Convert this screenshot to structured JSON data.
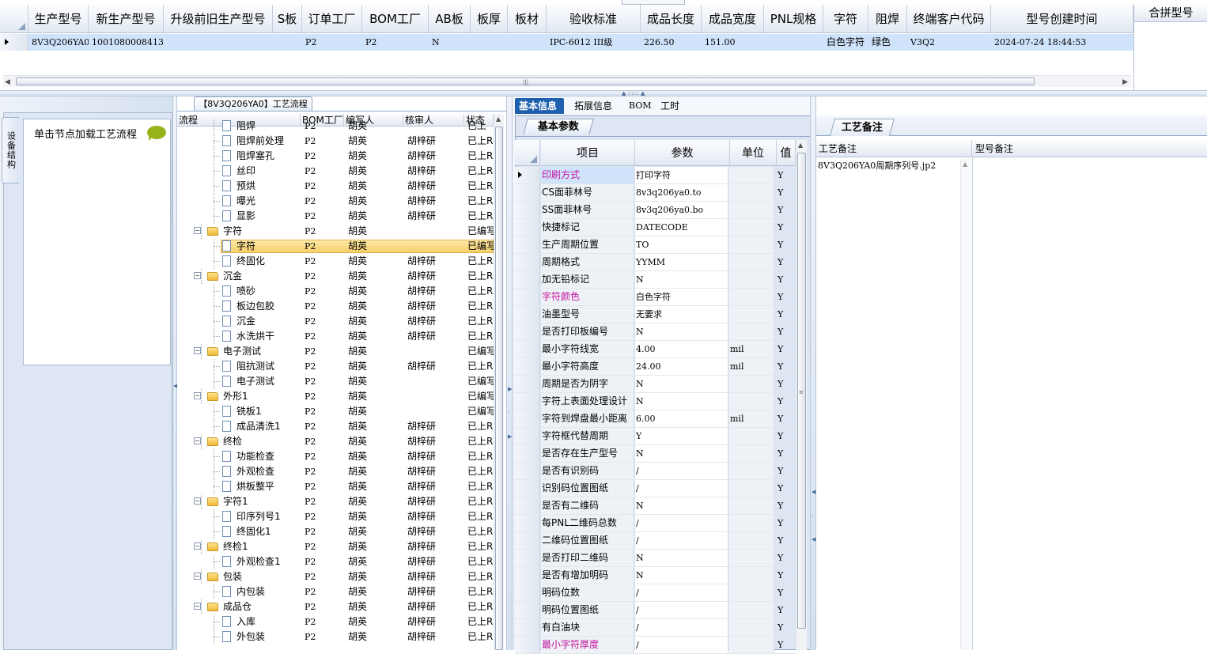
{
  "top_grid": {
    "columns": [
      "生产型号",
      "新生产型号",
      "升级前旧生产型号",
      "S板",
      "订单工厂",
      "BOM工厂",
      "AB板",
      "板厚",
      "板材",
      "验收标准",
      "成品长度",
      "成品宽度",
      "PNL规格",
      "字符",
      "阻焊",
      "终端客户代码",
      "型号创建时间"
    ],
    "row": [
      "8V3Q206YA0",
      "10010800084134",
      "",
      "",
      "P2",
      "P2",
      "N",
      "",
      "",
      "IPC-6012 III级",
      "226.50",
      "151.00",
      "",
      "白色字符",
      "绿色",
      "V3Q2",
      "2024-07-24 18:44:53"
    ],
    "side_title": "合拼型号"
  },
  "left_panel": {
    "vertical_tab": "设备结构",
    "hint": "单击节点加载工艺流程",
    "flow_tab_title": "【8V3Q206YA0】工艺流程"
  },
  "tree": {
    "columns": [
      "流程",
      "BOM工厂",
      "编写人",
      "核审人",
      "状态"
    ],
    "rows": [
      {
        "level": 1,
        "name": "阻焊",
        "bom": "P2",
        "w": "胡英",
        "r": "",
        "s": "已上 "
      },
      {
        "level": 1,
        "name": "阻焊前处理",
        "bom": "P2",
        "w": "胡英",
        "r": "胡梓研",
        "s": "已上R"
      },
      {
        "level": 1,
        "name": "阻焊塞孔",
        "bom": "P2",
        "w": "胡英",
        "r": "胡梓研",
        "s": "已上R"
      },
      {
        "level": 1,
        "name": "丝印",
        "bom": "P2",
        "w": "胡英",
        "r": "胡梓研",
        "s": "已上R"
      },
      {
        "level": 1,
        "name": "预烘",
        "bom": "P2",
        "w": "胡英",
        "r": "胡梓研",
        "s": "已上R"
      },
      {
        "level": 1,
        "name": "曝光",
        "bom": "P2",
        "w": "胡英",
        "r": "胡梓研",
        "s": "已上R"
      },
      {
        "level": 1,
        "name": "显影",
        "bom": "P2",
        "w": "胡英",
        "r": "胡梓研",
        "s": "已上R"
      },
      {
        "level": 0,
        "name": "字符",
        "bom": "P2",
        "w": "胡英",
        "r": "",
        "s": "已编写"
      },
      {
        "level": 1,
        "name": "字符",
        "bom": "P2",
        "w": "胡英",
        "r": "",
        "s": "已编写",
        "selected": true
      },
      {
        "level": 1,
        "name": "终固化",
        "bom": "P2",
        "w": "胡英",
        "r": "胡梓研",
        "s": "已上R"
      },
      {
        "level": 0,
        "name": "沉金",
        "bom": "P2",
        "w": "胡英",
        "r": "胡梓研",
        "s": "已上R"
      },
      {
        "level": 1,
        "name": "喷砂",
        "bom": "P2",
        "w": "胡英",
        "r": "胡梓研",
        "s": "已上R"
      },
      {
        "level": 1,
        "name": "板边包胶",
        "bom": "P2",
        "w": "胡英",
        "r": "胡梓研",
        "s": "已上R"
      },
      {
        "level": 1,
        "name": "沉金",
        "bom": "P2",
        "w": "胡英",
        "r": "胡梓研",
        "s": "已上R"
      },
      {
        "level": 1,
        "name": "水洗烘干",
        "bom": "P2",
        "w": "胡英",
        "r": "胡梓研",
        "s": "已上R"
      },
      {
        "level": 0,
        "name": "电子测试",
        "bom": "P2",
        "w": "胡英",
        "r": "",
        "s": "已编写"
      },
      {
        "level": 1,
        "name": "阻抗测试",
        "bom": "P2",
        "w": "胡英",
        "r": "胡梓研",
        "s": "已上R"
      },
      {
        "level": 1,
        "name": "电子测试",
        "bom": "P2",
        "w": "胡英",
        "r": "",
        "s": "已编写"
      },
      {
        "level": 0,
        "name": "外形1",
        "bom": "P2",
        "w": "胡英",
        "r": "",
        "s": "已编写"
      },
      {
        "level": 1,
        "name": "铣板1",
        "bom": "P2",
        "w": "胡英",
        "r": "",
        "s": "已编写"
      },
      {
        "level": 1,
        "name": "成品清洗1",
        "bom": "P2",
        "w": "胡英",
        "r": "胡梓研",
        "s": "已上R"
      },
      {
        "level": 0,
        "name": "终检",
        "bom": "P2",
        "w": "胡英",
        "r": "胡梓研",
        "s": "已上R"
      },
      {
        "level": 1,
        "name": "功能检查",
        "bom": "P2",
        "w": "胡英",
        "r": "胡梓研",
        "s": "已上R"
      },
      {
        "level": 1,
        "name": "外观检查",
        "bom": "P2",
        "w": "胡英",
        "r": "胡梓研",
        "s": "已上R"
      },
      {
        "level": 1,
        "name": "烘板整平",
        "bom": "P2",
        "w": "胡英",
        "r": "胡梓研",
        "s": "已上R"
      },
      {
        "level": 0,
        "name": "字符1",
        "bom": "P2",
        "w": "胡英",
        "r": "胡梓研",
        "s": "已上R"
      },
      {
        "level": 1,
        "name": "印序列号1",
        "bom": "P2",
        "w": "胡英",
        "r": "胡梓研",
        "s": "已上R"
      },
      {
        "level": 1,
        "name": "终固化1",
        "bom": "P2",
        "w": "胡英",
        "r": "胡梓研",
        "s": "已上R"
      },
      {
        "level": 0,
        "name": "终检1",
        "bom": "P2",
        "w": "胡英",
        "r": "胡梓研",
        "s": "已上R"
      },
      {
        "level": 1,
        "name": "外观检查1",
        "bom": "P2",
        "w": "胡英",
        "r": "胡梓研",
        "s": "已上R"
      },
      {
        "level": 0,
        "name": "包装",
        "bom": "P2",
        "w": "胡英",
        "r": "胡梓研",
        "s": "已上R"
      },
      {
        "level": 1,
        "name": "内包装",
        "bom": "P2",
        "w": "胡英",
        "r": "胡梓研",
        "s": "已上R"
      },
      {
        "level": 0,
        "name": "成品仓",
        "bom": "P2",
        "w": "胡英",
        "r": "胡梓研",
        "s": "已上R"
      },
      {
        "level": 1,
        "name": "入库",
        "bom": "P2",
        "w": "胡英",
        "r": "胡梓研",
        "s": "已上R"
      },
      {
        "level": 1,
        "name": "外包装",
        "bom": "P2",
        "w": "胡英",
        "r": "胡梓研",
        "s": "已上R"
      }
    ]
  },
  "mid_tabs": [
    "基本信息",
    "拓展信息",
    "BOM",
    "工时"
  ],
  "params": {
    "subtab": "基本参数",
    "columns": [
      "项目",
      "参数",
      "单位",
      "值"
    ],
    "rows": [
      {
        "k": "印刷方式",
        "v": "打印字符",
        "u": "",
        "f": "Y",
        "hl": true,
        "cur": true
      },
      {
        "k": "CS面菲林号",
        "v": "8v3q206ya0.to",
        "u": "",
        "f": "Y"
      },
      {
        "k": "SS面菲林号",
        "v": "8v3q206ya0.bo",
        "u": "",
        "f": "Y"
      },
      {
        "k": "快捷标记",
        "v": "DATECODE",
        "u": "",
        "f": "Y"
      },
      {
        "k": "生产周期位置",
        "v": "TO",
        "u": "",
        "f": "Y"
      },
      {
        "k": "周期格式",
        "v": "YYMM",
        "u": "",
        "f": "Y"
      },
      {
        "k": "加无铅标记",
        "v": "N",
        "u": "",
        "f": "Y"
      },
      {
        "k": "字符颜色",
        "v": "白色字符",
        "u": "",
        "f": "Y",
        "hl": true
      },
      {
        "k": "油墨型号",
        "v": "无要求",
        "u": "",
        "f": "Y"
      },
      {
        "k": "是否打印板编号",
        "v": "N",
        "u": "",
        "f": "Y"
      },
      {
        "k": "最小字符线宽",
        "v": "4.00",
        "u": "mil",
        "f": "Y"
      },
      {
        "k": "最小字符高度",
        "v": "24.00",
        "u": "mil",
        "f": "Y"
      },
      {
        "k": "周期是否为阴字",
        "v": "N",
        "u": "",
        "f": "Y"
      },
      {
        "k": "字符上表面处理设计",
        "v": "N",
        "u": "",
        "f": "Y"
      },
      {
        "k": "字符到焊盘最小距离",
        "v": "6.00",
        "u": "mil",
        "f": "Y"
      },
      {
        "k": "字符框代替周期",
        "v": "Y",
        "u": "",
        "f": "Y"
      },
      {
        "k": "是否存在生产型号",
        "v": "N",
        "u": "",
        "f": "Y"
      },
      {
        "k": "是否有识别码",
        "v": "/",
        "u": "",
        "f": "Y"
      },
      {
        "k": "识别码位置图纸",
        "v": "/",
        "u": "",
        "f": "Y"
      },
      {
        "k": "是否有二维码",
        "v": "N",
        "u": "",
        "f": "Y"
      },
      {
        "k": "每PNL二维码总数",
        "v": "/",
        "u": "",
        "f": "Y"
      },
      {
        "k": "二维码位置图纸",
        "v": "/",
        "u": "",
        "f": "Y"
      },
      {
        "k": "是否打印二维码",
        "v": "N",
        "u": "",
        "f": "Y"
      },
      {
        "k": "是否有增加明码",
        "v": "N",
        "u": "",
        "f": "Y"
      },
      {
        "k": "明码位数",
        "v": "/",
        "u": "",
        "f": "Y"
      },
      {
        "k": "明码位置图纸",
        "v": "/",
        "u": "",
        "f": "Y"
      },
      {
        "k": "有白油块",
        "v": "/",
        "u": "",
        "f": "Y"
      },
      {
        "k": "最小字符厚度",
        "v": "/",
        "u": "",
        "f": "Y",
        "hl": true
      }
    ]
  },
  "remarks": {
    "tab": "工艺备注",
    "col1": "工艺备注",
    "col2": "型号备注",
    "text": "8V3Q206YA0周期序列号.jp2"
  },
  "colors": {
    "accent": "#1f5fb0",
    "selection": "#cfe3fb",
    "tree_selected": "#fbd77a",
    "highlight_key": "#c2139c"
  }
}
